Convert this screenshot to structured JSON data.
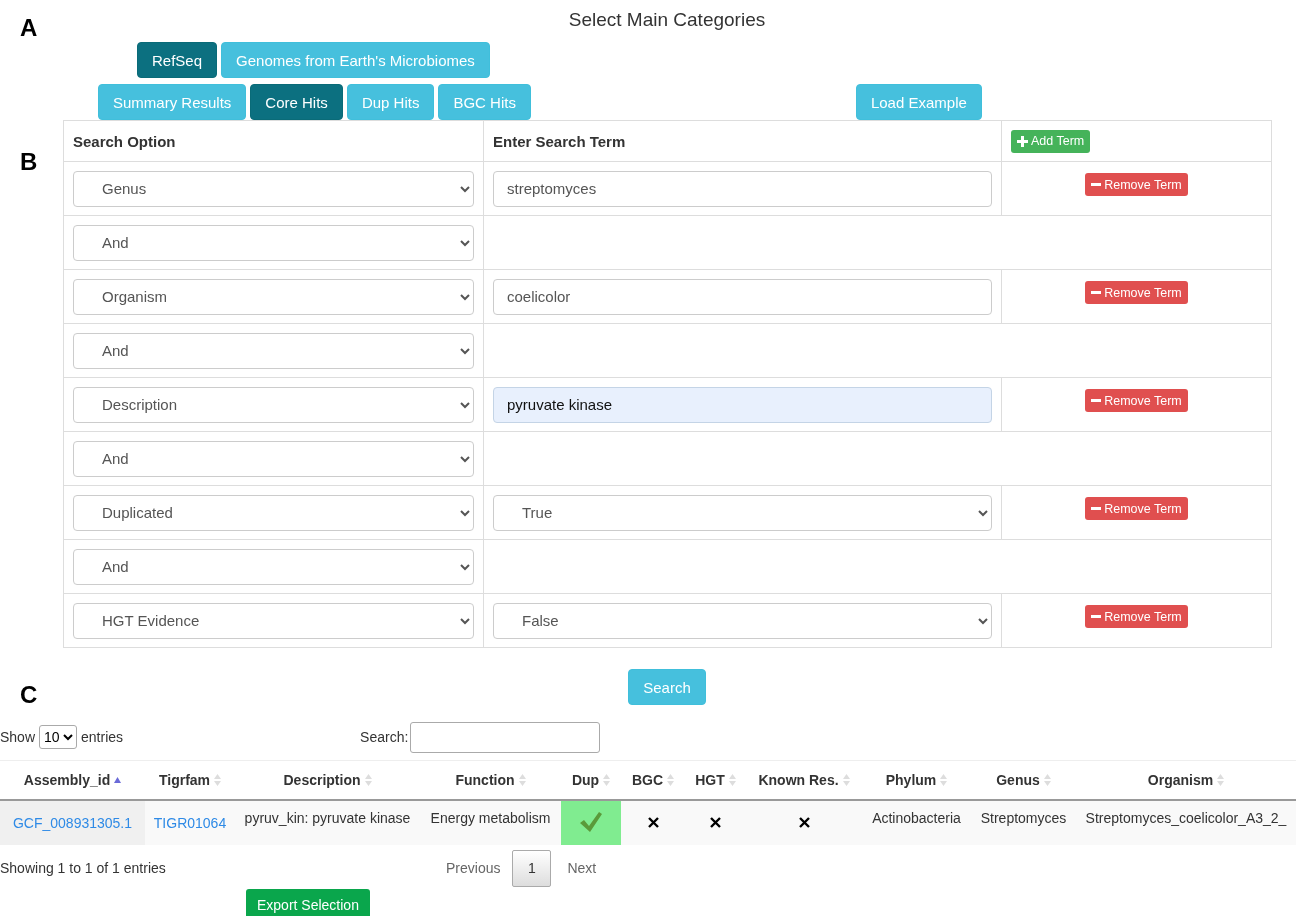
{
  "panel_labels": [
    "A",
    "B",
    "C"
  ],
  "title": "Select Main Categories",
  "categories": [
    {
      "label": "RefSeq",
      "selected": true
    },
    {
      "label": "Genomes from Earth's Microbiomes",
      "selected": false
    }
  ],
  "views": [
    {
      "label": "Summary Results",
      "selected": false
    },
    {
      "label": "Core Hits",
      "selected": true
    },
    {
      "label": "Dup Hits",
      "selected": false
    },
    {
      "label": "BGC Hits",
      "selected": false
    }
  ],
  "load_example": "Load Example",
  "query": {
    "columns": [
      "Search Option",
      "Enter Search Term"
    ],
    "add_term": "Add Term",
    "rows": [
      {
        "kind": "term",
        "option": "Genus",
        "term": {
          "kind": "text",
          "value": "streptomyces",
          "highlighted": false
        },
        "remove": "Remove Term"
      },
      {
        "kind": "operator",
        "option": "And"
      },
      {
        "kind": "term",
        "option": "Organism",
        "term": {
          "kind": "text",
          "value": "coelicolor",
          "highlighted": false
        },
        "remove": "Remove Term"
      },
      {
        "kind": "operator",
        "option": "And"
      },
      {
        "kind": "term",
        "option": "Description",
        "term": {
          "kind": "text",
          "value": "pyruvate kinase",
          "highlighted": true
        },
        "remove": "Remove Term"
      },
      {
        "kind": "operator",
        "option": "And"
      },
      {
        "kind": "term",
        "option": "Duplicated",
        "term": {
          "kind": "select",
          "value": "True"
        },
        "remove": "Remove Term"
      },
      {
        "kind": "operator",
        "option": "And"
      },
      {
        "kind": "term",
        "option": "HGT Evidence",
        "term": {
          "kind": "select",
          "value": "False"
        },
        "remove": "Remove Term"
      }
    ]
  },
  "search_button": "Search",
  "results": {
    "show_label": "Show",
    "length": "10",
    "entries_label": "entries",
    "search_label": "Search:",
    "columns": [
      {
        "label": "Assembly_id",
        "sorted": true
      },
      {
        "label": "Tigrfam",
        "sorted": false
      },
      {
        "label": "Description",
        "sorted": false
      },
      {
        "label": "Function",
        "sorted": false
      },
      {
        "label": "Dup",
        "sorted": false
      },
      {
        "label": "BGC",
        "sorted": false
      },
      {
        "label": "HGT",
        "sorted": false
      },
      {
        "label": "Known Res.",
        "sorted": false
      },
      {
        "label": "Phylum",
        "sorted": false
      },
      {
        "label": "Genus",
        "sorted": false
      },
      {
        "label": "Organism",
        "sorted": false
      }
    ],
    "rows": [
      [
        {
          "kind": "link",
          "text": "GCF_008931305.1"
        },
        {
          "kind": "link",
          "text": "TIGR01064"
        },
        {
          "kind": "text",
          "text": "pyruv_kin: pyruvate kinase"
        },
        {
          "kind": "text",
          "text": "Energy metabolism"
        },
        {
          "kind": "flag",
          "value": true
        },
        {
          "kind": "flag",
          "value": false
        },
        {
          "kind": "flag",
          "value": false
        },
        {
          "kind": "flag",
          "value": false
        },
        {
          "kind": "text",
          "text": "Actinobacteria"
        },
        {
          "kind": "text",
          "text": "Streptomyces"
        },
        {
          "kind": "text",
          "text": "Streptomyces_coelicolor_A3_2_"
        }
      ]
    ],
    "info": "Showing 1 to 1 of 1 entries",
    "previous": "Previous",
    "pages": [
      {
        "label": "1",
        "selected": true
      }
    ],
    "next": "Next"
  },
  "export": "Export Selection"
}
